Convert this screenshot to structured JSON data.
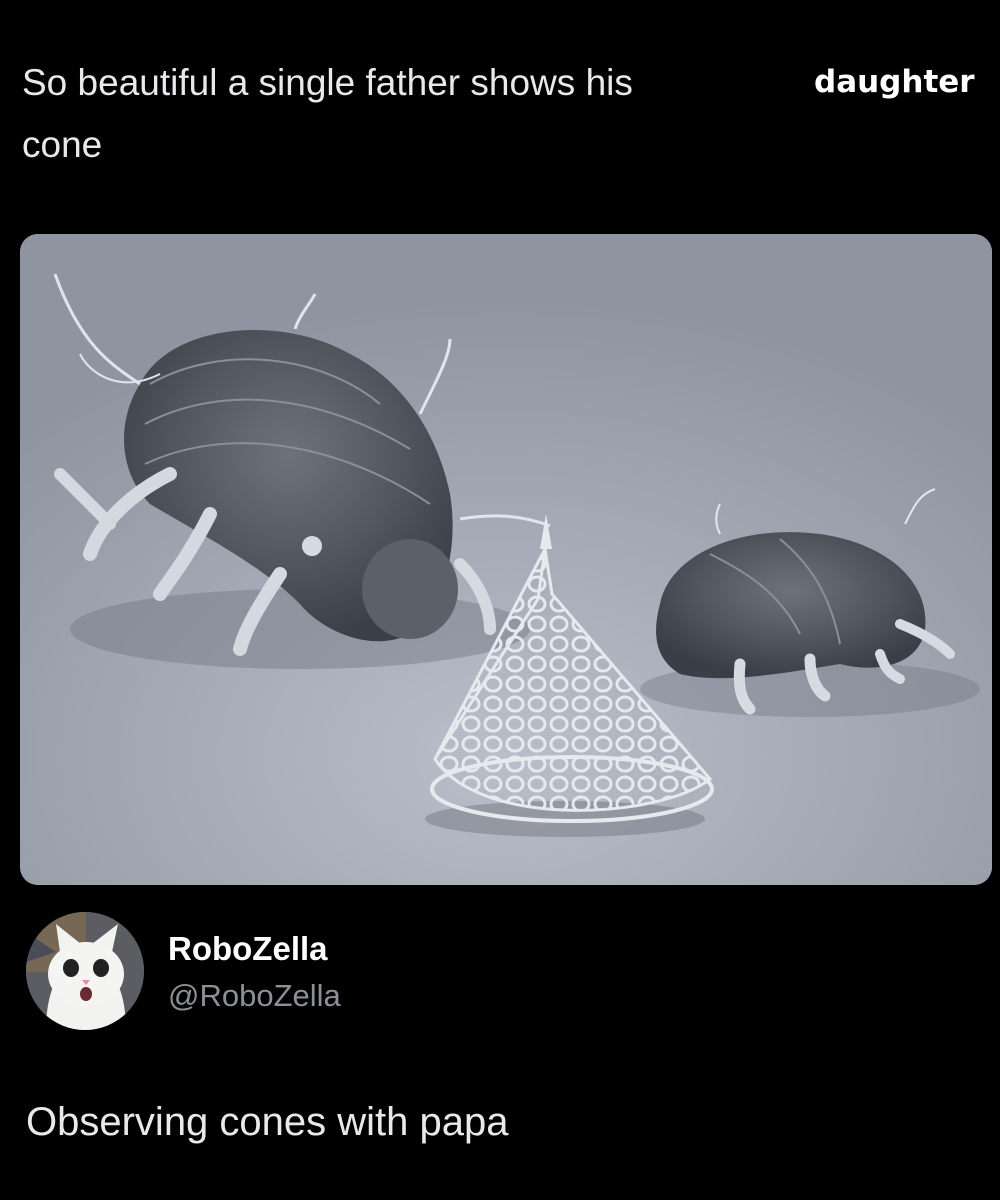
{
  "quote": {
    "line1": "So beautiful a single father shows his",
    "line2": "cone",
    "overlay_word": "daughter"
  },
  "media": {
    "subject": "tardigrade-with-radiolarian-cone-icon"
  },
  "author": {
    "display_name": "RoboZella",
    "handle": "@RoboZella",
    "avatar": "cat-avatar-icon"
  },
  "tweet": {
    "text": "Observing cones with papa"
  },
  "colors": {
    "background": "#000000",
    "text": "#e7e9ea",
    "handle": "#8b9097"
  }
}
